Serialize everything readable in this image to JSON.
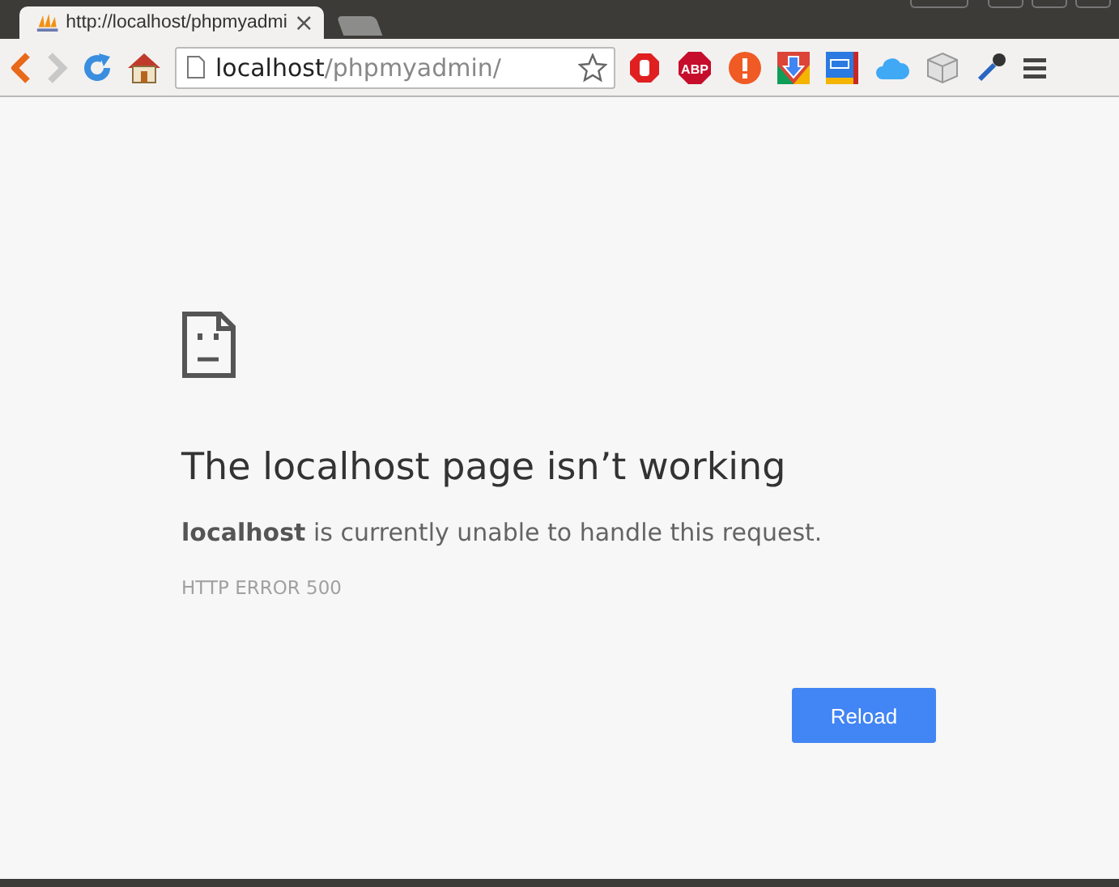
{
  "tabs": [
    {
      "title": "http://localhost/phpmyadmi",
      "selected": true,
      "close": "×"
    }
  ],
  "address": {
    "host": "localhost",
    "path": "/phpmyadmin/"
  },
  "extensions": {
    "abp_label": "ABP"
  },
  "error": {
    "title": "The localhost page isn’t working",
    "message": "**localhost** is currently unable to handle this request.",
    "code": "HTTP ERROR 500",
    "button": "Reload"
  }
}
